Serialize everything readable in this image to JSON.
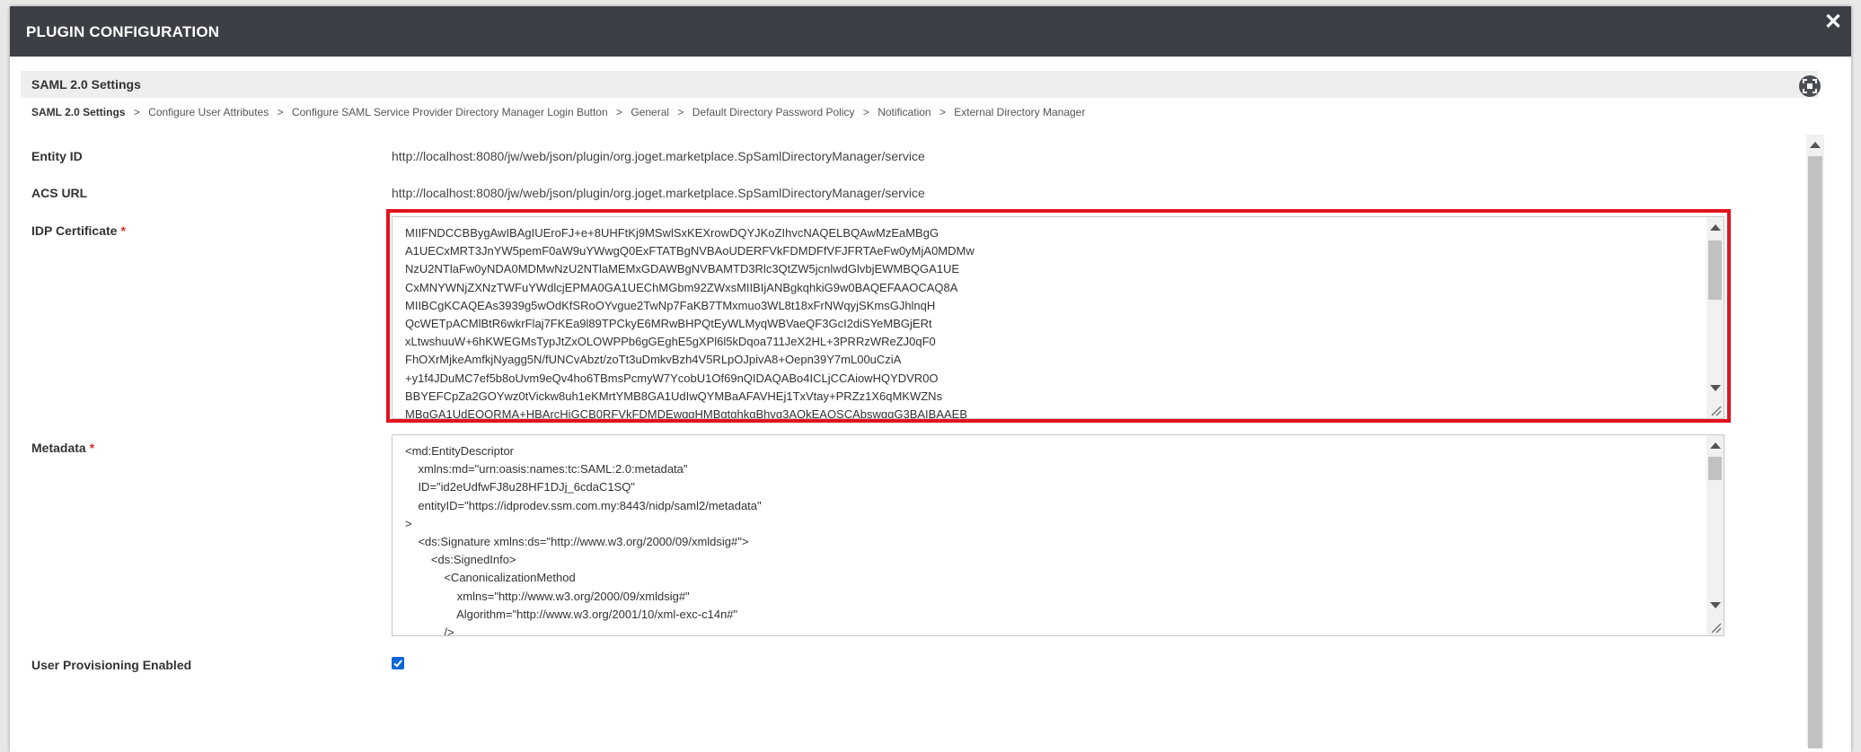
{
  "dialog": {
    "title": "PLUGIN CONFIGURATION",
    "close_glyph": "✕"
  },
  "section": {
    "title": "SAML 2.0 Settings",
    "fullscreen_icon": "fullscreen-icon"
  },
  "breadcrumb": [
    "SAML 2.0 Settings",
    "Configure User Attributes",
    "Configure SAML Service Provider Directory Manager Login Button",
    "General",
    "Default Directory Password Policy",
    "Notification",
    "External Directory Manager"
  ],
  "breadcrumb_separator": ">",
  "fields": {
    "entity_id": {
      "label": "Entity ID",
      "value": "http://localhost:8080/jw/web/json/plugin/org.joget.marketplace.SpSamlDirectoryManager/service"
    },
    "acs_url": {
      "label": "ACS URL",
      "value": "http://localhost:8080/jw/web/json/plugin/org.joget.marketplace.SpSamlDirectoryManager/service"
    },
    "idp_certificate": {
      "label": "IDP Certificate",
      "required_mark": "*",
      "value": "MIIFNDCCBBygAwIBAgIUEroFJ+e+8UHFtKj9MSwlSxKEXrowDQYJKoZIhvcNAQELBQAwMzEaMBgG\nA1UECxMRT3JnYW5pemF0aW9uYWwgQ0ExFTATBgNVBAoUDERFVkFDMDFfVFJFRTAeFw0yMjA0MDMw\nNzU2NTlaFw0yNDA0MDMwNzU2NTlaMEMxGDAWBgNVBAMTD3Rlc3QtZW5jcnlwdGlvbjEWMBQGA1UE\nCxMNYWNjZXNzTWFuYWdlcjEPMA0GA1UEChMGbm92ZWxsMIIBIjANBgkqhkiG9w0BAQEFAAOCAQ8A\nMIIBCgKCAQEAs3939g5wOdKfSRoOYvgue2TwNp7FaKB7TMxmuo3WL8t18xFrNWqyjSKmsGJhlnqH\nQcWETpACMlBtR6wkrFlaj7FKEa9l89TPCkyE6MRwBHPQtEyWLMyqWBVaeQF3GcI2diSYeMBGjERt\nxLtwshuuW+6hKWEGMsTypJtZxOLOWPPb6gGEghE5gXPl6l5kDqoa711JeX2HL+3PRRzWReZJ0qF0\nFhOXrMjkeAmfkjNyagg5N/fUNCvAbzt/zoTt3uDmkvBzh4V5RLpOJpivA8+Oepn39Y7mL00uCziA\n+y1f4JDuMC7ef5b8oUvm9eQv4ho6TBmsPcmyW7YcobU1Of69nQIDAQABo4ICLjCCAiowHQYDVR0O\nBBYEFCpZa2GOYwz0tVickw8uh1eKMrtYMB8GA1UdIwQYMBaAFAVHEj1TxVtay+PRZz1X6qMKWZNs\nMBgGA1UdEQQRMA+HBArcHjGCB0RFVkFDMDEwggHMBgtghkgBhvg3AQkEAQSCAbswggG3BAIBAAEB"
    },
    "metadata": {
      "label": "Metadata",
      "required_mark": "*",
      "value": "<md:EntityDescriptor\n    xmlns:md=\"urn:oasis:names:tc:SAML:2.0:metadata\"\n    ID=\"id2eUdfwFJ8u28HF1DJj_6cdaC1SQ\"\n    entityID=\"https://idprodev.ssm.com.my:8443/nidp/saml2/metadata\"\n>\n    <ds:Signature xmlns:ds=\"http://www.w3.org/2000/09/xmldsig#\">\n        <ds:SignedInfo>\n            <CanonicalizationMethod\n                xmlns=\"http://www.w3.org/2000/09/xmldsig#\"\n                Algorithm=\"http://www.w3.org/2001/10/xml-exc-c14n#\"\n            />"
    },
    "user_provisioning": {
      "label": "User Provisioning Enabled",
      "checked": true
    }
  },
  "colors": {
    "titlebar": "#3c4046",
    "highlight": "#e0141e",
    "checkbox": "#0a66d6"
  }
}
